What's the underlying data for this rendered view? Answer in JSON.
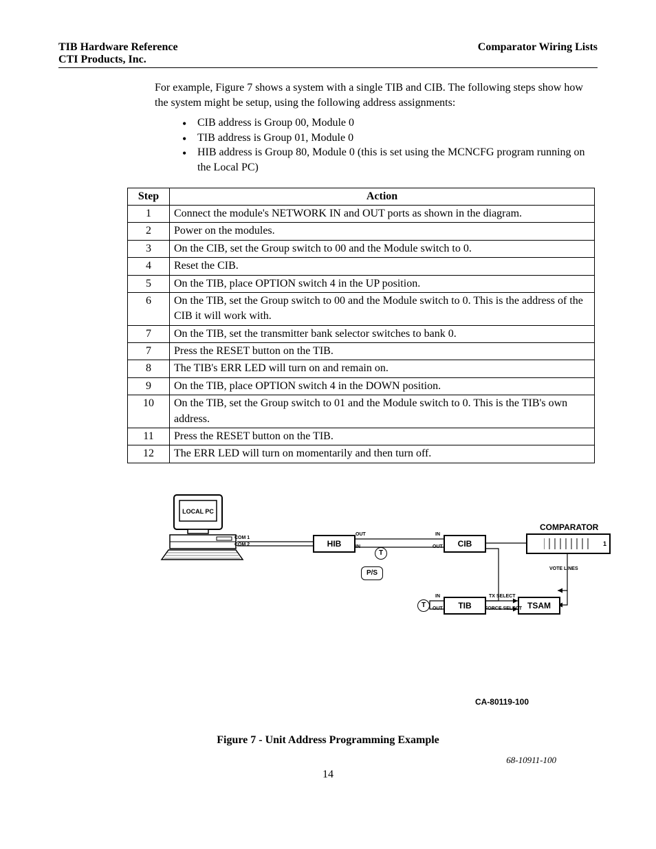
{
  "header": {
    "left_line1": "TIB Hardware Reference",
    "left_line2": "CTI Products, Inc.",
    "right": "Comparator Wiring Lists"
  },
  "intro": "For example, Figure 7 shows a system with a single TIB and CIB.  The following steps show how the system might be setup, using the following address assignments:",
  "bullets": [
    "CIB address is Group 00, Module 0",
    "TIB address is Group 01, Module 0",
    "HIB address is Group 80, Module 0 (this is set using the MCNCFG program running on the Local PC)"
  ],
  "table": {
    "headers": {
      "step": "Step",
      "action": "Action"
    },
    "rows": [
      {
        "step": "1",
        "action": "Connect  the module's NETWORK IN and OUT ports as shown in the diagram."
      },
      {
        "step": "2",
        "action": "Power on the modules."
      },
      {
        "step": "3",
        "action": "On the CIB, set the Group switch to 00 and the Module switch to 0."
      },
      {
        "step": "4",
        "action": "Reset the CIB."
      },
      {
        "step": "5",
        "action": "On the TIB, place OPTION switch 4 in the UP position."
      },
      {
        "step": "6",
        "action": "On the TIB, set the Group switch to 00 and the Module switch to 0.  This is the address of the CIB it will work with."
      },
      {
        "step": "7",
        "action": "On the TIB, set the transmitter bank selector switches to bank 0."
      },
      {
        "step": "7",
        "action": "Press the RESET button on the TIB."
      },
      {
        "step": "8",
        "action": "The TIB's ERR LED will turn on and remain on."
      },
      {
        "step": "9",
        "action": "On the TIB, place OPTION switch 4 in the DOWN position."
      },
      {
        "step": "10",
        "action": "On the TIB, set the Group switch to 01 and the Module switch to 0.  This is the TIB's own address."
      },
      {
        "step": "11",
        "action": "Press the RESET button on the TIB."
      },
      {
        "step": "12",
        "action": "The ERR LED will turn on momentarily and then turn off."
      }
    ]
  },
  "diagram": {
    "local_pc": "LOCAL PC",
    "hib": "HIB",
    "cib": "CIB",
    "tib": "TIB",
    "tsam": "TSAM",
    "comparator": "COMPARATOR",
    "ps": "P/S",
    "t": "T",
    "out": "OUT",
    "in": "IN",
    "com1": "COM 1",
    "com2": "COM 2",
    "vote_lines": "VOTE LINES",
    "tx_select": "TX SELECT",
    "force_select": "FORCE SELECT",
    "one": "1"
  },
  "part_number": "CA-80119-100",
  "figure_caption": "Figure 7 - Unit Address Programming Example",
  "doc_number": "68-10911-100",
  "page_number": "14"
}
